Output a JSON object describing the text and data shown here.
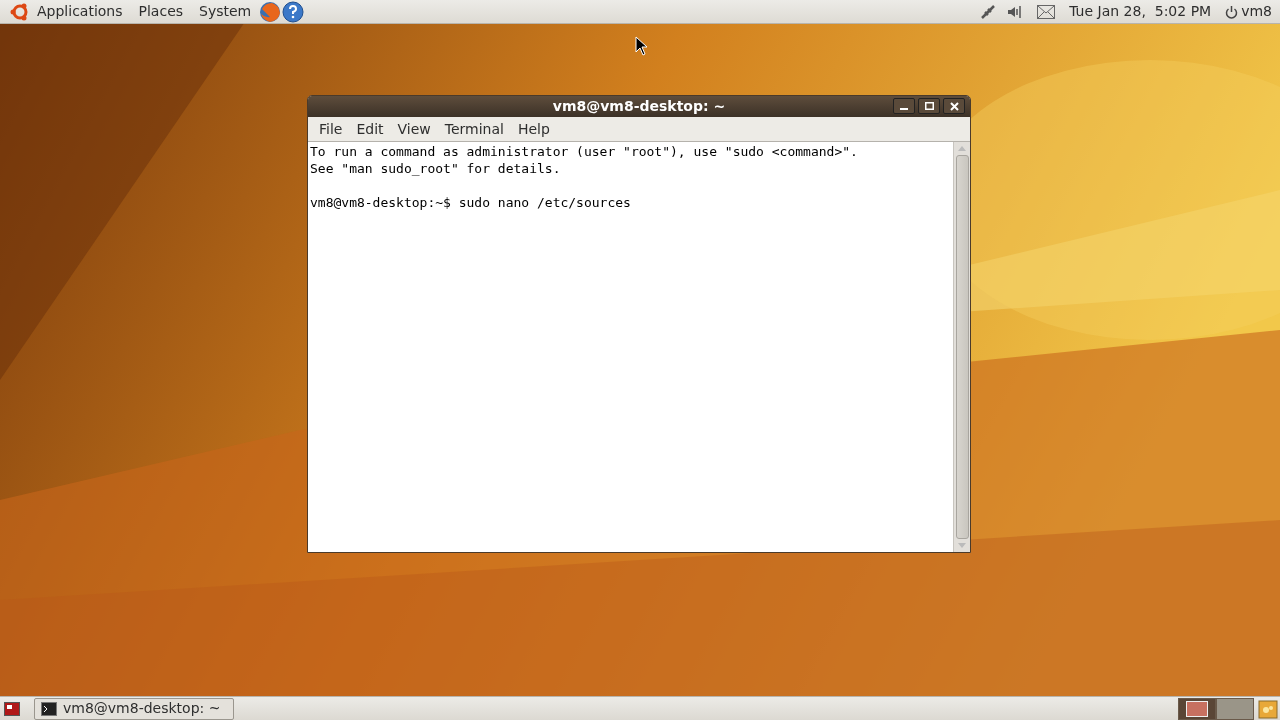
{
  "top_panel": {
    "menus": [
      "Applications",
      "Places",
      "System"
    ],
    "clock": "Tue Jan 28,  5:02 PM",
    "user": "vm8"
  },
  "window": {
    "title": "vm8@vm8-desktop: ~",
    "menu": [
      "File",
      "Edit",
      "View",
      "Terminal",
      "Help"
    ],
    "notice": [
      "To run a command as administrator (user \"root\"), use \"sudo <command>\".",
      "See \"man sudo_root\" for details."
    ],
    "prompt": "vm8@vm8-desktop:~$ sudo nano /etc/sources"
  },
  "taskbar": {
    "tasks": [
      {
        "label": "vm8@vm8-desktop: ~",
        "selected": false
      }
    ],
    "workspaces": [
      {
        "selected": true
      },
      {
        "selected": false
      }
    ]
  }
}
